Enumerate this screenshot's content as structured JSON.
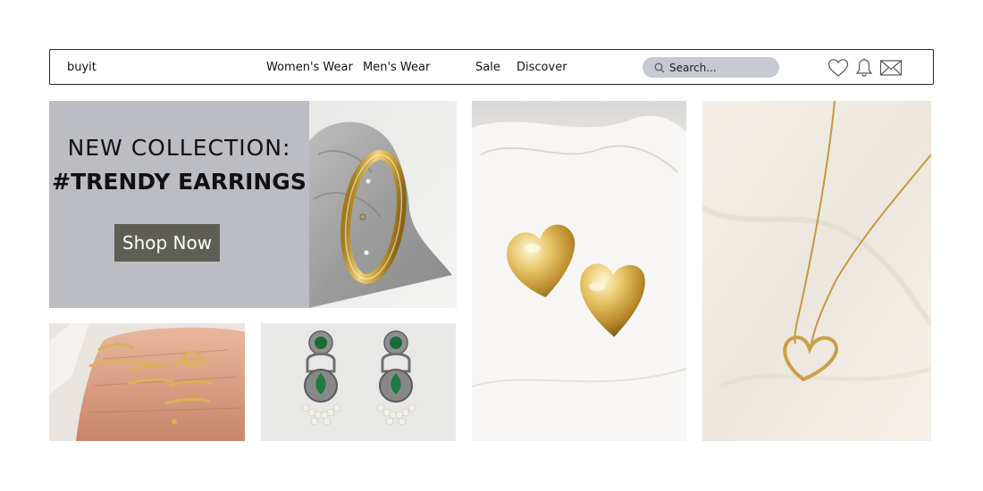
{
  "navbar": {
    "logo": "buyit",
    "links": [
      "Women's Wear",
      "Men's Wear",
      "Sale",
      "Discover"
    ],
    "search": {
      "placeholder": "Search..."
    },
    "icons": [
      "heart-icon",
      "bell-icon",
      "mail-icon"
    ]
  },
  "promo": {
    "line1": "NEW COLLECTION:",
    "line2": "#TRENDY EARRINGS",
    "button": "Shop Now"
  },
  "products": [
    {
      "image": "gold-bangle-photo"
    },
    {
      "image": "gold-heart-earrings-photo"
    },
    {
      "image": "gold-heart-necklace-photo"
    },
    {
      "image": "gold-rings-on-hand-photo"
    },
    {
      "image": "green-stone-earrings-photo"
    }
  ],
  "colors": {
    "promo_bg": "#bcbdc3",
    "button_bg": "#5e5e56",
    "search_bg": "#c6c8d2",
    "gold": "#d4aa3c"
  }
}
